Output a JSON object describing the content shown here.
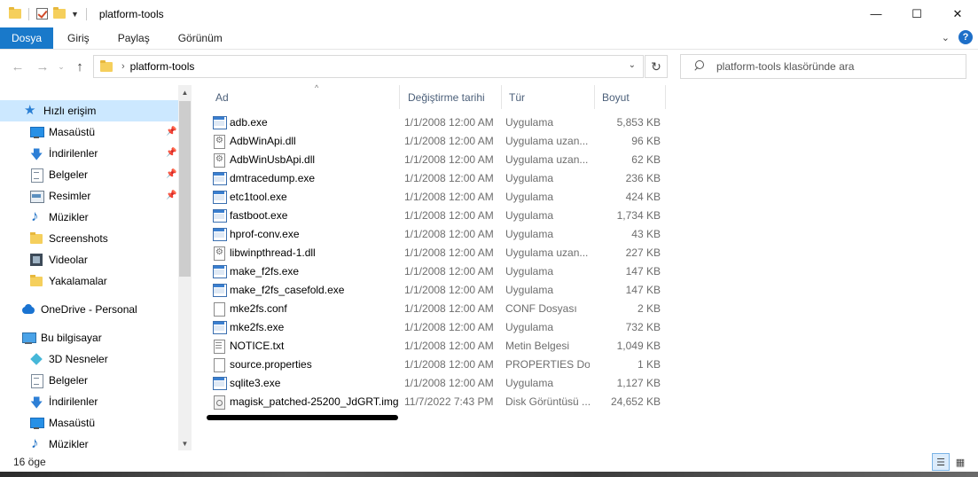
{
  "window": {
    "title": "platform-tools",
    "controls": {
      "minimize": "—",
      "maximize": "☐",
      "close": "✕"
    }
  },
  "ribbon": {
    "tabs": [
      {
        "label": "Dosya"
      },
      {
        "label": "Giriş"
      },
      {
        "label": "Paylaş"
      },
      {
        "label": "Görünüm"
      }
    ],
    "help": "?"
  },
  "address": {
    "path": "platform-tools",
    "search_placeholder": "platform-tools klasöründe ara"
  },
  "sidebar": {
    "items": [
      {
        "label": "Hızlı erişim",
        "icon": "star-icon",
        "pinned": false,
        "selected": true
      },
      {
        "label": "Masaüstü",
        "icon": "desktop-icon",
        "pinned": true
      },
      {
        "label": "İndirilenler",
        "icon": "download-icon",
        "pinned": true
      },
      {
        "label": "Belgeler",
        "icon": "documents-icon",
        "pinned": true
      },
      {
        "label": "Resimler",
        "icon": "pictures-icon",
        "pinned": true
      },
      {
        "label": "Müzikler",
        "icon": "music-icon",
        "pinned": false
      },
      {
        "label": "Screenshots",
        "icon": "folder-icon",
        "pinned": false
      },
      {
        "label": "Videolar",
        "icon": "video-icon",
        "pinned": false
      },
      {
        "label": "Yakalamalar",
        "icon": "folder-icon",
        "pinned": false
      },
      {
        "label": "OneDrive - Personal",
        "icon": "cloud-icon",
        "pinned": false
      },
      {
        "label": "Bu bilgisayar",
        "icon": "computer-icon",
        "pinned": false
      },
      {
        "label": "3D Nesneler",
        "icon": "3d-objects-icon",
        "pinned": false
      },
      {
        "label": "Belgeler",
        "icon": "documents-icon",
        "pinned": false
      },
      {
        "label": "İndirilenler",
        "icon": "download-icon",
        "pinned": false
      },
      {
        "label": "Masaüstü",
        "icon": "desktop-icon",
        "pinned": false
      },
      {
        "label": "Müzikler",
        "icon": "music-icon",
        "pinned": false
      }
    ]
  },
  "columns": {
    "name": "Ad",
    "date": "Değiştirme tarihi",
    "type": "Tür",
    "size": "Boyut"
  },
  "files": [
    {
      "name": "adb.exe",
      "date": "1/1/2008 12:00 AM",
      "type": "Uygulama",
      "size": "5,853 KB",
      "icon": "exe"
    },
    {
      "name": "AdbWinApi.dll",
      "date": "1/1/2008 12:00 AM",
      "type": "Uygulama uzan...",
      "size": "96 KB",
      "icon": "dll"
    },
    {
      "name": "AdbWinUsbApi.dll",
      "date": "1/1/2008 12:00 AM",
      "type": "Uygulama uzan...",
      "size": "62 KB",
      "icon": "dll"
    },
    {
      "name": "dmtracedump.exe",
      "date": "1/1/2008 12:00 AM",
      "type": "Uygulama",
      "size": "236 KB",
      "icon": "exe"
    },
    {
      "name": "etc1tool.exe",
      "date": "1/1/2008 12:00 AM",
      "type": "Uygulama",
      "size": "424 KB",
      "icon": "exe"
    },
    {
      "name": "fastboot.exe",
      "date": "1/1/2008 12:00 AM",
      "type": "Uygulama",
      "size": "1,734 KB",
      "icon": "exe"
    },
    {
      "name": "hprof-conv.exe",
      "date": "1/1/2008 12:00 AM",
      "type": "Uygulama",
      "size": "43 KB",
      "icon": "exe"
    },
    {
      "name": "libwinpthread-1.dll",
      "date": "1/1/2008 12:00 AM",
      "type": "Uygulama uzan...",
      "size": "227 KB",
      "icon": "dll"
    },
    {
      "name": "make_f2fs.exe",
      "date": "1/1/2008 12:00 AM",
      "type": "Uygulama",
      "size": "147 KB",
      "icon": "exe"
    },
    {
      "name": "make_f2fs_casefold.exe",
      "date": "1/1/2008 12:00 AM",
      "type": "Uygulama",
      "size": "147 KB",
      "icon": "exe"
    },
    {
      "name": "mke2fs.conf",
      "date": "1/1/2008 12:00 AM",
      "type": "CONF Dosyası",
      "size": "2 KB",
      "icon": "file"
    },
    {
      "name": "mke2fs.exe",
      "date": "1/1/2008 12:00 AM",
      "type": "Uygulama",
      "size": "732 KB",
      "icon": "exe"
    },
    {
      "name": "NOTICE.txt",
      "date": "1/1/2008 12:00 AM",
      "type": "Metin Belgesi",
      "size": "1,049 KB",
      "icon": "txt"
    },
    {
      "name": "source.properties",
      "date": "1/1/2008 12:00 AM",
      "type": "PROPERTIES Do...",
      "size": "1 KB",
      "icon": "file"
    },
    {
      "name": "sqlite3.exe",
      "date": "1/1/2008 12:00 AM",
      "type": "Uygulama",
      "size": "1,127 KB",
      "icon": "exe"
    },
    {
      "name": "magisk_patched-25200_JdGRT.img",
      "date": "11/7/2022 7:43 PM",
      "type": "Disk Görüntüsü ...",
      "size": "24,652 KB",
      "icon": "img"
    }
  ],
  "status": {
    "item_count": "16 öge"
  }
}
